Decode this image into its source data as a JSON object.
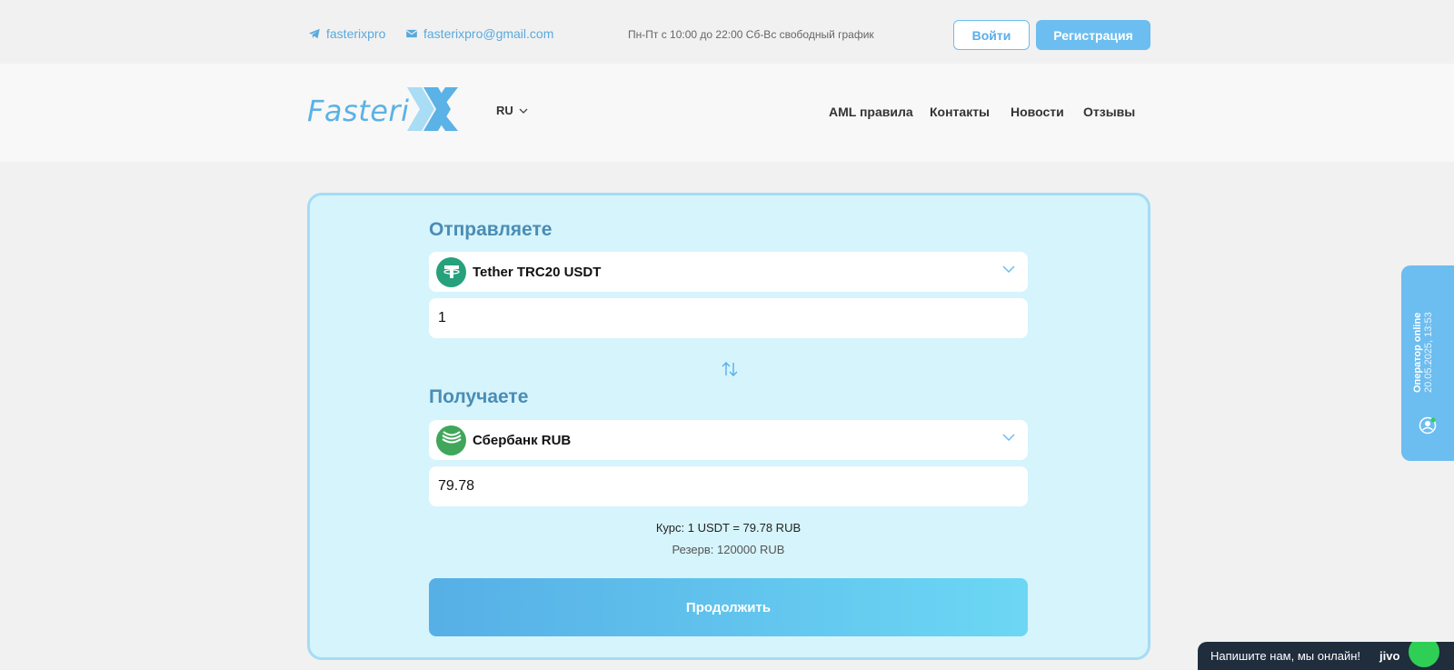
{
  "topbar": {
    "telegram_label": "fasterixpro",
    "email_label": "fasterixpro@gmail.com",
    "hours": "Пн-Пт с 10:00 до 22:00 Сб-Вс свободный график",
    "login_label": "Войти",
    "register_label": "Регистрация"
  },
  "header": {
    "logo_text": "Fasteri",
    "logo_letter": "X",
    "language": "RU",
    "nav": [
      "AML правила",
      "Контакты",
      "Новости",
      "Отзывы"
    ]
  },
  "exchange": {
    "send_label": "Отправляете",
    "send_currency": "Tether TRC20 USDT",
    "send_amount": "1",
    "receive_label": "Получаете",
    "receive_currency": "Сбербанк RUB",
    "receive_amount": "79.78",
    "rate": "Курс: 1 USDT = 79.78 RUB",
    "reserve": "Резерв: 120000 RUB",
    "continue_label": "Продолжить"
  },
  "operator": {
    "status": "Оператор online",
    "datetime": "20.05.2025, 13:53"
  },
  "chat": {
    "prompt": "Напишите нам, мы онлайн!",
    "brand": "jivo"
  },
  "colors": {
    "accent": "#6cbdf0",
    "card_bg": "#d6f4fc",
    "tether": "#26a17b",
    "sber": "#21a038"
  }
}
